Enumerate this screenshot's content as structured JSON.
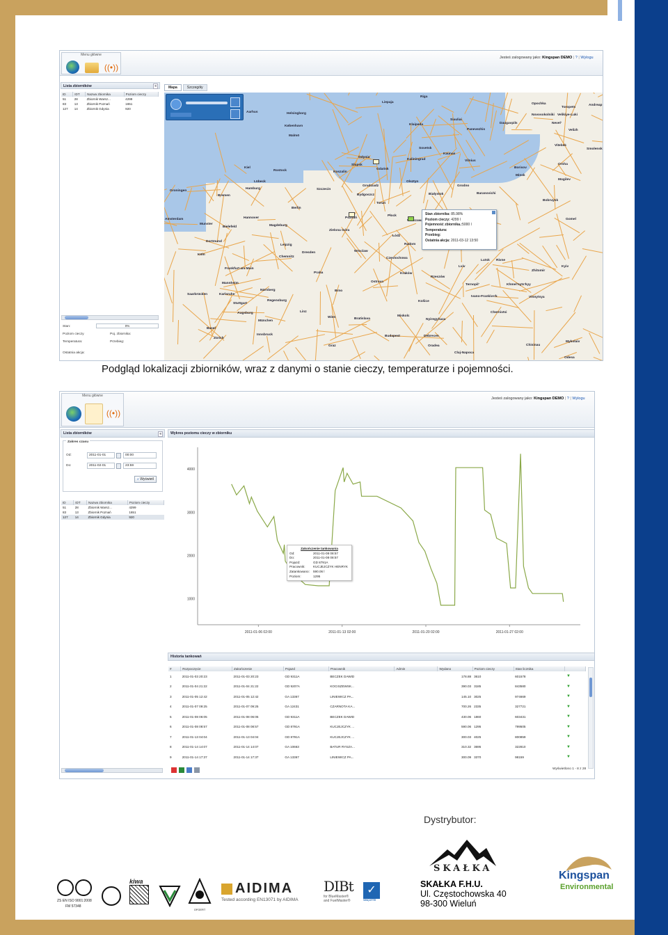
{
  "caption": "Podgląd lokalizacji zbiorników, wraz z danymi o stanie cieczy, temperaturze i pojemności.",
  "screenshot1": {
    "menu_title": "Menu główne",
    "login_prefix": "Jesteś zalogowany jako:",
    "login_user": "Kingspan DEMO",
    "logout_label": "Wylogu",
    "tank_list_title": "Lista zbiorników",
    "tank_columns": [
      "ID",
      "IDT",
      "Nazwa zbiornika",
      "Poziom cieczy"
    ],
    "tanks": [
      [
        "51",
        "28",
        "Zbiornik Warsz...",
        "4299"
      ],
      [
        "83",
        "13",
        "Zbiornik Poznań",
        "1651"
      ],
      [
        "127",
        "14",
        "Zbiornik Gdynia",
        "920"
      ]
    ],
    "tabs": [
      "Mapa",
      "Szczegóły"
    ],
    "status_labels": {
      "stan": "Stan:",
      "stan_value": "0%",
      "poziom": "Poziom cieczy",
      "poj": "Poj. zbiornika:",
      "temp": "Temperatura:",
      "przebieg": "Przebieg:",
      "ostatnia": "Ostatnia akcja:"
    },
    "popup": {
      "stan_label": "Stan zbiornika:",
      "stan_value": "85.98%",
      "poziom_label": "Poziom cieczy:",
      "poziom_value": "4299 l",
      "poj_label": "Pojemność zbiornika.:",
      "poj_value": "5000 l",
      "temp_label": "Temperatura:",
      "przebieg_label": "Przebieg:",
      "ostatnia_label": "Ostatnia akcja:",
      "ostatnia_value": "2011-03-12 13:50"
    },
    "cities": [
      [
        "Riga",
        "603",
        "140"
      ],
      [
        "Opochka",
        "763",
        "150"
      ],
      [
        "Toropets",
        "806",
        "155"
      ],
      [
        "Andreap",
        "845",
        "152"
      ],
      [
        "Liepaja",
        "548",
        "148"
      ],
      [
        "Siauliai",
        "646",
        "173"
      ],
      [
        "Daugavpils",
        "717",
        "178"
      ],
      [
        "Velikiye-Luki",
        "800",
        "166"
      ],
      [
        "Novosokolniki",
        "763",
        "166"
      ],
      [
        "Nevel'",
        "792",
        "178"
      ],
      [
        "Aarhus",
        "353",
        "162"
      ],
      [
        "Helsingborg",
        "411",
        "164"
      ],
      [
        "København",
        "408",
        "182"
      ],
      [
        "Malmö",
        "414",
        "196"
      ],
      [
        "Klaipeda",
        "587",
        "180"
      ],
      [
        "Panevezhis",
        "670",
        "187"
      ],
      [
        "Velizh",
        "816",
        "188"
      ],
      [
        "Smolensk",
        "842",
        "215"
      ],
      [
        "Vitebsk",
        "796",
        "210"
      ],
      [
        "Sovetsk",
        "601",
        "214"
      ],
      [
        "Kaunas",
        "636",
        "222"
      ],
      [
        "Kaliningrad",
        "584",
        "230"
      ],
      [
        "Vilnius",
        "667",
        "232"
      ],
      [
        "Orsha",
        "801",
        "237"
      ],
      [
        "Gdynia",
        "514",
        "227"
      ],
      [
        "Gdańsk",
        "540",
        "244"
      ],
      [
        "Slupsk",
        "504",
        "238"
      ],
      [
        "Olsztyn",
        "583",
        "262"
      ],
      [
        "Minsk",
        "740",
        "253"
      ],
      [
        "Borisov",
        "738",
        "242"
      ],
      [
        "Mogilev",
        "801",
        "259"
      ],
      [
        "Kiel",
        "350",
        "242"
      ],
      [
        "Lübeck",
        "364",
        "262"
      ],
      [
        "Rostock",
        "392",
        "246"
      ],
      [
        "Koszalin",
        "478",
        "248"
      ],
      [
        "Grudziadz",
        "520",
        "268"
      ],
      [
        "Bydgoszcz",
        "512",
        "281"
      ],
      [
        "Toruń",
        "540",
        "293"
      ],
      [
        "Białystok",
        "615",
        "280"
      ],
      [
        "Grodno",
        "656",
        "268"
      ],
      [
        "Hamburg",
        "352",
        "272"
      ],
      [
        "Groningen",
        "243",
        "275"
      ],
      [
        "Szczecin",
        "454",
        "273"
      ],
      [
        "Bremen",
        "312",
        "282"
      ],
      [
        "Bobruysk",
        "779",
        "289"
      ],
      [
        "Baranovichi",
        "684",
        "279"
      ],
      [
        "Gomel",
        "812",
        "316"
      ],
      [
        "Amsterdam",
        "236",
        "316"
      ],
      [
        "Berlin",
        "418",
        "300"
      ],
      [
        "Poznań",
        "495",
        "314"
      ],
      [
        "Płock",
        "556",
        "311"
      ],
      [
        "Warszawa",
        "584",
        "318"
      ],
      [
        "Munster",
        "286",
        "323"
      ],
      [
        "Hannover",
        "349",
        "314"
      ],
      [
        "Bielefeld",
        "319",
        "327"
      ],
      [
        "Magdeburg",
        "386",
        "325"
      ],
      [
        "Zielona Góra",
        "472",
        "332"
      ],
      [
        "Łódź",
        "563",
        "340"
      ],
      [
        "Radom",
        "580",
        "352"
      ],
      [
        "Dortmund",
        "295",
        "348"
      ],
      [
        "Leipzig",
        "402",
        "353"
      ],
      [
        "Dresden",
        "433",
        "364"
      ],
      [
        "Wroclaw",
        "508",
        "362"
      ],
      [
        "Częstochowa",
        "554",
        "372"
      ],
      [
        "Köln",
        "283",
        "367"
      ],
      [
        "Chemnitz",
        "400",
        "370"
      ],
      [
        "Lutsk",
        "690",
        "375"
      ],
      [
        "Rivne",
        "712",
        "375"
      ],
      [
        "Frankfurt am Main",
        "322",
        "387"
      ],
      [
        "Praha",
        "450",
        "393"
      ],
      [
        "Ostrava",
        "532",
        "406"
      ],
      [
        "Kraków",
        "574",
        "394"
      ],
      [
        "Rzeszów",
        "618",
        "399"
      ],
      [
        "Lviv",
        "658",
        "384"
      ],
      [
        "Zhitomir",
        "763",
        "390"
      ],
      [
        "Kyiv",
        "806",
        "384"
      ],
      [
        "Mannheim",
        "318",
        "408"
      ],
      [
        "Nürnberg",
        "373",
        "418"
      ],
      [
        "Brno",
        "480",
        "419"
      ],
      [
        "Ternopil'",
        "668",
        "410"
      ],
      [
        "Khmel'nyts'kyy",
        "727",
        "410"
      ],
      [
        "Saarbrücken",
        "268",
        "424"
      ],
      [
        "Karlsruhe",
        "314",
        "424"
      ],
      [
        "Ivano-Frankivs'k",
        "676",
        "427"
      ],
      [
        "Vinnytsya",
        "759",
        "428"
      ],
      [
        "Stuttgart",
        "334",
        "437"
      ],
      [
        "Regensburg",
        "383",
        "433"
      ],
      [
        "Košice",
        "600",
        "434"
      ],
      [
        "Augsburg",
        "340",
        "451"
      ],
      [
        "Linz",
        "430",
        "449"
      ],
      [
        "Wien",
        "470",
        "457"
      ],
      [
        "Bratislava",
        "508",
        "459"
      ],
      [
        "Miskolc",
        "570",
        "455"
      ],
      [
        "Chernivtsi",
        "704",
        "450"
      ],
      [
        "Nyiregyhaza",
        "611",
        "460"
      ],
      [
        "München",
        "370",
        "462"
      ],
      [
        "Basel",
        "296",
        "473"
      ],
      [
        "Innsbruck",
        "368",
        "482"
      ],
      [
        "Budapest",
        "552",
        "484"
      ],
      [
        "Debrecen",
        "608",
        "484"
      ],
      [
        "Zürich",
        "306",
        "487"
      ],
      [
        "Oradea",
        "614",
        "498"
      ],
      [
        "Chisinau",
        "755",
        "497"
      ],
      [
        "Mykolaiv",
        "812",
        "492"
      ],
      [
        "Graz",
        "471",
        "498"
      ],
      [
        "Cluj-Napoca",
        "652",
        "508"
      ],
      [
        "Odesa",
        "810",
        "515"
      ]
    ]
  },
  "screenshot2": {
    "menu_title": "Menu główne",
    "login_prefix": "Jesteś zalogowany jako:",
    "login_user": "Kingspan DEMO",
    "logout_label": "Wylogu",
    "tank_list_title": "Lista zbiorników",
    "range_title": "Zakres czasu",
    "from_label": "Od:",
    "from_date": "2011-01-01",
    "from_time": "00:00",
    "to_label": "Do:",
    "to_date": "2011-02-01",
    "to_time": "23:59",
    "show_button": "Wyświetl",
    "tank_columns": [
      "ID",
      "IDT",
      "Nazwa zbiornika",
      "Poziom cieczy"
    ],
    "tanks": [
      [
        "51",
        "28",
        "Zbiornik Warsz...",
        "4299"
      ],
      [
        "83",
        "13",
        "Zbiornik Poznań",
        "1651"
      ],
      [
        "127",
        "14",
        "Zbiornik Gdynia",
        "920"
      ]
    ],
    "chart_title": "Wykres poziomu cieczy w zbiorniku",
    "tooltip": {
      "title": "Zakończenie tankowania",
      "rows": [
        [
          "Od:",
          "2011-01-08 08:57"
        ],
        [
          "Do:",
          "2011-01-08 08:57"
        ],
        [
          "Pojazd:",
          "GD 8791A"
        ],
        [
          "Pracownik:",
          "KUCJEJCZYK HENRYK"
        ],
        [
          "Zatankowano:",
          "590.06 l"
        ],
        [
          "Poziom:",
          "1295"
        ]
      ]
    },
    "history_title": "Historia tankowań",
    "history_columns": [
      "#",
      "Rozpoczęcie",
      "Zakończenie",
      "Pojazd",
      "Pracownik",
      "Admin",
      "Wydano",
      "Poziom cieczy",
      "Stan licznika"
    ],
    "history": [
      [
        "1",
        "2011-01-03 20:23",
        "2011-01-03 20:23",
        "GD 9311A",
        "BECZEK DAWID",
        "",
        "178.88",
        "3610",
        "601578"
      ],
      [
        "2",
        "2011-01-04 21:22",
        "2011-01-04 21:22",
        "GD 9207A",
        "KOCISZEWSK...",
        "",
        "390.03",
        "3185",
        "843580"
      ],
      [
        "3",
        "2011-01-05 12:42",
        "2011-01-05 12:42",
        "GA 13367",
        "LINIEWICZ PA...",
        "",
        "145.10",
        "3025",
        "974669"
      ],
      [
        "4",
        "2011-01-07 09:25",
        "2011-01-07 09:25",
        "GA 12431",
        "CZARNOTA KA...",
        "",
        "700.26",
        "2335",
        "327721"
      ],
      [
        "5",
        "2011-01-08 06:05",
        "2011-01-08 06:05",
        "GD 9311A",
        "BECZEK DAWID",
        "",
        "430.06",
        "1860",
        "603431"
      ],
      [
        "6",
        "2011-01-08 08:57",
        "2011-01-08 08:57",
        "GD 8791A",
        "KUCJEJCZYK ...",
        "",
        "590.06",
        "1295",
        "799505"
      ],
      [
        "7",
        "2011-01-13 04:04",
        "2011-01-13 04:04",
        "GD 8791A",
        "KUCJEJCZYK ...",
        "",
        "300.03",
        "4025",
        "800859"
      ],
      [
        "8",
        "2011-01-14 14:07",
        "2011-01-14 14:07",
        "GA 10663",
        "BATUR RYSZA...",
        "",
        "310.32",
        "3695",
        "322810"
      ],
      [
        "9",
        "2011-01-14 17:37",
        "2011-01-14 17:37",
        "GA 13367",
        "LINIEWICZ PA...",
        "",
        "300.09",
        "3370",
        "98159"
      ]
    ],
    "pager_text": "Wyświetlono 1 - 8 z 28"
  },
  "chart_data": {
    "type": "line",
    "title": "",
    "xlabel": "",
    "ylabel": "",
    "y_ticks": [
      1000,
      2000,
      3000,
      4000
    ],
    "x_ticks": [
      "2011-01-06 02:00",
      "2011-01-13 02:00",
      "2011-01-20 02:00",
      "2011-01-27 02:00"
    ],
    "xlim": [
      "2011-01-01 00:00",
      "2011-02-01 23:59"
    ],
    "ylim": [
      400,
      4500
    ],
    "series": [
      {
        "color": "#8aa848",
        "points": [
          [
            "2011-01-03 20:00",
            3650
          ],
          [
            "2011-01-04 06:00",
            3400
          ],
          [
            "2011-01-04 21:00",
            3610
          ],
          [
            "2011-01-05 08:00",
            3200
          ],
          [
            "2011-01-05 12:00",
            3350
          ],
          [
            "2011-01-06 00:00",
            3020
          ],
          [
            "2011-01-06 20:00",
            2660
          ],
          [
            "2011-01-07 09:00",
            2900
          ],
          [
            "2011-01-07 16:00",
            2350
          ],
          [
            "2011-01-08 04:00",
            2050
          ],
          [
            "2011-01-08 06:00",
            2250
          ],
          [
            "2011-01-08 08:00",
            1870
          ],
          [
            "2011-01-09 00:00",
            1580
          ],
          [
            "2011-01-10 00:00",
            1330
          ],
          [
            "2011-01-11 02:00",
            1300
          ],
          [
            "2011-01-12 00:00",
            1300
          ],
          [
            "2011-01-12 12:00",
            3500
          ],
          [
            "2011-01-13 00:00",
            3900
          ],
          [
            "2011-01-13 04:00",
            4030
          ],
          [
            "2011-01-13 06:00",
            3700
          ],
          [
            "2011-01-13 12:00",
            3900
          ],
          [
            "2011-01-14 00:00",
            3650
          ],
          [
            "2011-01-14 14:00",
            3700
          ],
          [
            "2011-01-14 17:00",
            3370
          ],
          [
            "2011-01-16 00:00",
            3370
          ],
          [
            "2011-01-18 00:00",
            3100
          ],
          [
            "2011-01-19 00:00",
            2800
          ],
          [
            "2011-01-19 12:00",
            2300
          ],
          [
            "2011-01-20 00:00",
            2100
          ],
          [
            "2011-01-20 12:00",
            1700
          ],
          [
            "2011-01-21 00:00",
            1360
          ],
          [
            "2011-01-21 08:00",
            850
          ],
          [
            "2011-01-22 12:00",
            850
          ],
          [
            "2011-01-22 14:00",
            4030
          ],
          [
            "2011-01-24 20:00",
            4030
          ],
          [
            "2011-01-25 00:00",
            3050
          ],
          [
            "2011-01-25 12:00",
            2950
          ],
          [
            "2011-01-26 00:00",
            2400
          ],
          [
            "2011-01-26 20:00",
            2280
          ],
          [
            "2011-01-27 04:00",
            1250
          ],
          [
            "2011-01-27 14:00",
            1250
          ],
          [
            "2011-01-28 00:00",
            4350
          ],
          [
            "2011-01-28 06:00",
            1750
          ],
          [
            "2011-01-28 16:00",
            1250
          ],
          [
            "2011-01-29 00:00",
            1120
          ],
          [
            "2011-01-31 12:00",
            1120
          ],
          [
            "2011-01-31 14:00",
            930
          ]
        ]
      }
    ],
    "grid": false
  },
  "footer": {
    "distributor_label": "Dystrybutor:",
    "company_logo_word": "SKAŁKA",
    "company_name": "SKAŁKA F.H.U.",
    "address_line1": "Ul. Częstochowska 40",
    "address_line2": "98-300 Wieluń",
    "kingspan_line1": "Kingspan",
    "kingspan_line2": "Environmental",
    "aidima_word": "AIDIMA",
    "aidima_sub": "Tested according EN13071 by AIDIMA",
    "dibt_word": "DIBt",
    "dibt_sub1": "for BlueMaster®",
    "dibt_sub2": "and FuelMaster®",
    "iso_line1": "ZS EN ISO 9001:2008",
    "iso_line2": "FM 57348",
    "kiwa_word": "kiwa",
    "vincotte_word": "VINÇOTTE",
    "ofgert_word": "OFGERT"
  },
  "colors": {
    "gold": "#c9a25e",
    "blue": "#0b3f8c",
    "chart_line": "#8aa848",
    "kingspan_blue": "#1a4f9c",
    "kingspan_green": "#5aa02c"
  }
}
